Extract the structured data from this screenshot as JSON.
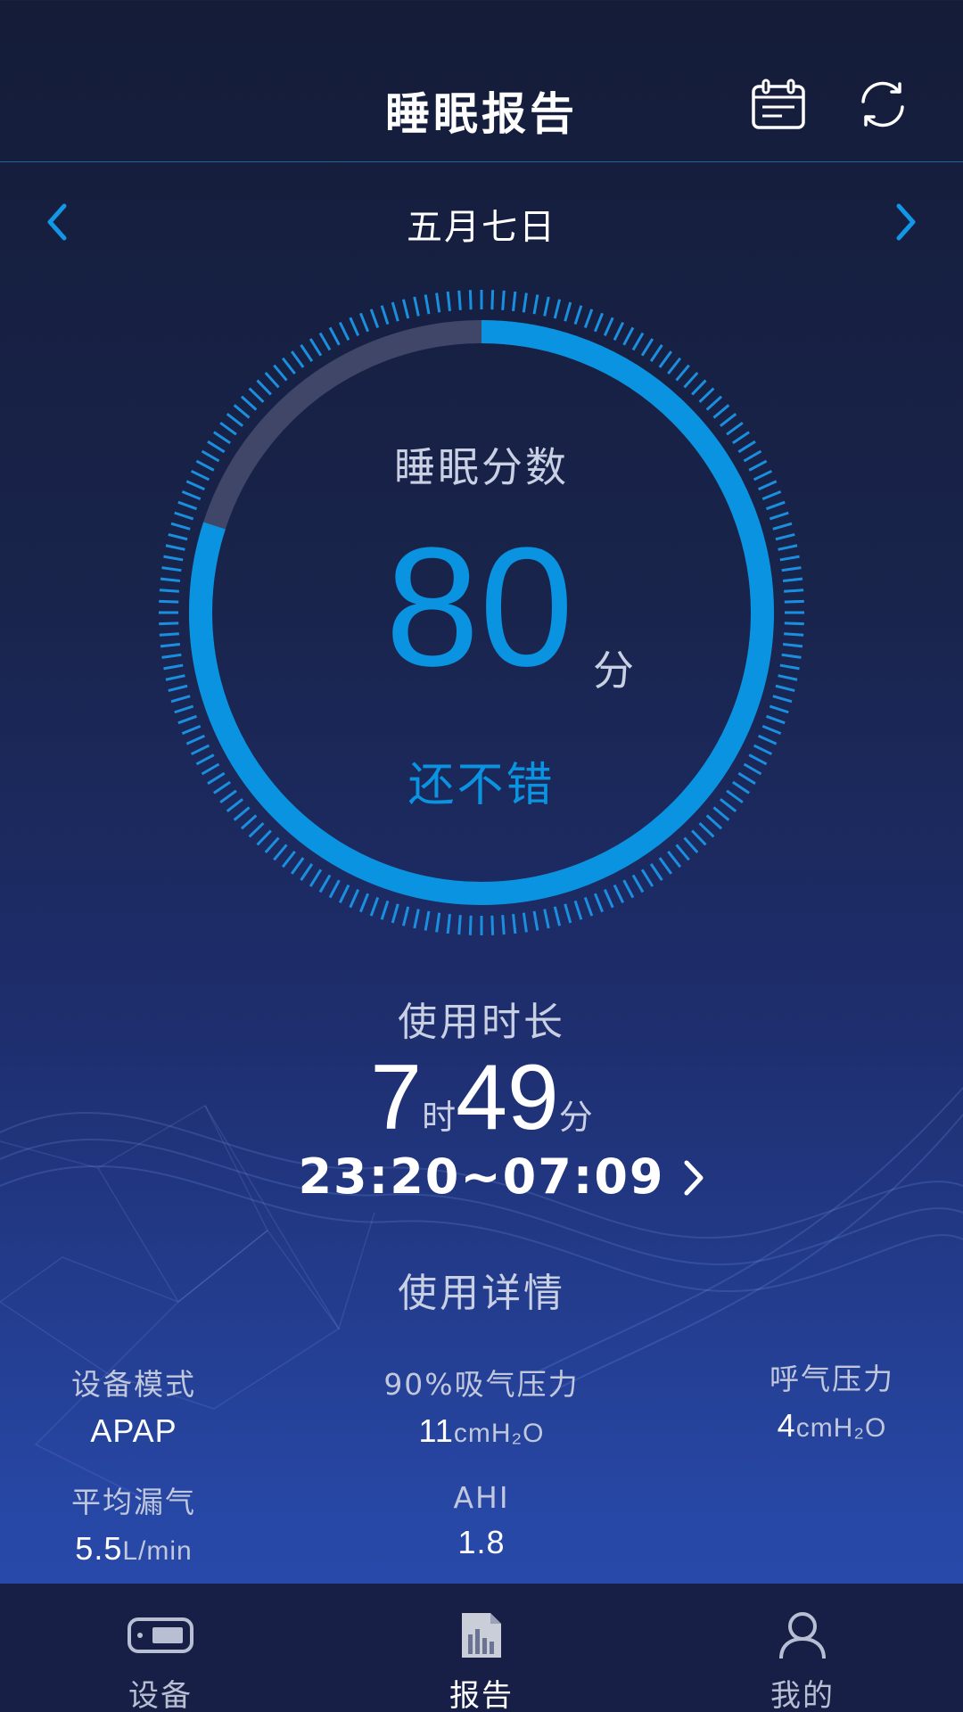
{
  "header": {
    "title": "睡眠报告",
    "calendar_icon": "calendar-icon",
    "refresh_icon": "refresh-icon"
  },
  "date_nav": {
    "label": "五月七日",
    "prev_icon": "chevron-left-icon",
    "next_icon": "chevron-right-icon"
  },
  "score": {
    "title": "睡眠分数",
    "value": "80",
    "unit": "分",
    "comment": "还不错",
    "fraction": 0.8
  },
  "duration": {
    "title": "使用时长",
    "hours": "7",
    "hours_unit": "时",
    "minutes": "49",
    "minutes_unit": "分",
    "range": "23:20~07:09"
  },
  "details": {
    "title": "使用详情",
    "mode": {
      "label": "设备模式",
      "value": "APAP"
    },
    "pressure90": {
      "label": "90%吸气压力",
      "value": "11",
      "unit": "cmH₂O"
    },
    "exhale": {
      "label": "呼气压力",
      "value": "4",
      "unit": "cmH₂O"
    },
    "leak": {
      "label": "平均漏气",
      "value": "5.5",
      "unit": "L/min"
    },
    "ahi": {
      "label": "AHI",
      "value": "1.8"
    }
  },
  "nav": {
    "device": "设备",
    "report": "报告",
    "mine": "我的"
  },
  "colors": {
    "accent": "#0a93e0",
    "background_top": "#141c38",
    "background_bottom": "#2a4db2",
    "nav_bg": "#171f47"
  }
}
